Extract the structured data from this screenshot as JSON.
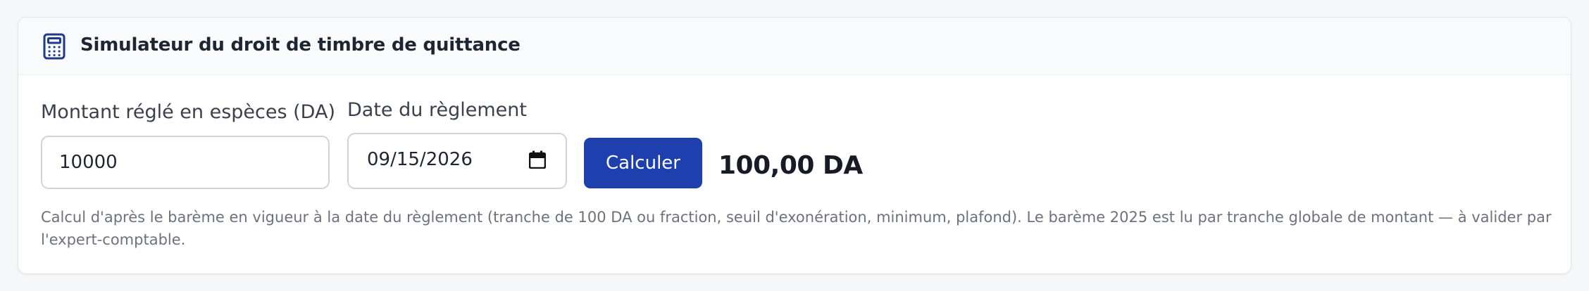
{
  "card": {
    "icon": "calculator-icon",
    "title": "Simulateur du droit de timbre de quittance"
  },
  "form": {
    "amount": {
      "label": "Montant réglé en espèces (DA)",
      "value": "10000"
    },
    "date": {
      "label": "Date du règlement",
      "value": "09/15/2026",
      "icon": "calendar-icon"
    },
    "submit_label": "Calculer"
  },
  "result": {
    "value": "100,00 DA"
  },
  "note": "Calcul d'après le barème en vigueur à la date du règlement (tranche de 100 DA ou fraction, seuil d'exonération, minimum, plafond). Le barème 2025 est lu par tranche globale de montant — à valider par l'expert-comptable.",
  "colors": {
    "accent": "#1e3fae",
    "icon": "#1f3a8a",
    "page_background": "#f6f7f9",
    "card_background": "#ffffff",
    "header_background": "#f9fafb"
  }
}
